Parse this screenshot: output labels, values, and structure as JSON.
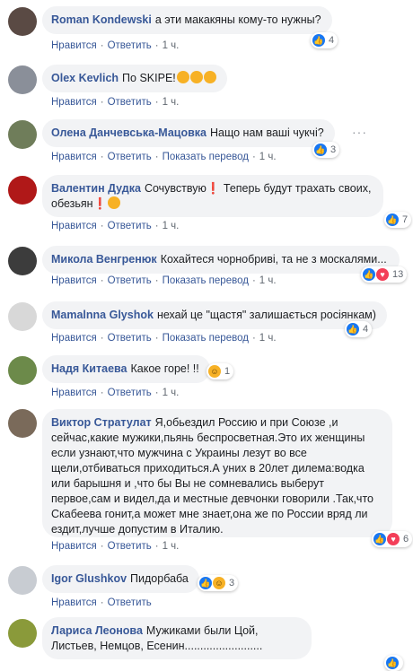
{
  "actions": {
    "like": "Нравится",
    "reply": "Ответить",
    "translate": "Показать перевод"
  },
  "comments": [
    {
      "name": "Roman Kondewski",
      "text": "а эти макакяны кому-то нужны?",
      "time": "1 ч.",
      "reactions": "4",
      "avatar_color": "#5a4a44"
    },
    {
      "name": "Olex Kevlich",
      "text": "По SKIPE!",
      "time": "1 ч.",
      "reactions": "",
      "avatar_color": "#8a8f99"
    },
    {
      "name": "Олена Данчевська-Мацовка",
      "text": "Нащо нам ваші чукчі?",
      "time": "1 ч.",
      "reactions": "3",
      "avatar_color": "#6f7d5a"
    },
    {
      "name": "Валентин Дудка",
      "text": "Сочувствую❗ Теперь будут трахать своих, обезьян❗",
      "time": "1 ч.",
      "reactions": "7",
      "avatar_color": "#b01818"
    },
    {
      "name": "Микола Венгренюк",
      "text": "Кохайтеся чорнобриві, та не з москалями...",
      "time": "1 ч.",
      "reactions": "13",
      "avatar_color": "#3c3c3c"
    },
    {
      "name": "Mamalnna Glyshok",
      "text": "нехай це \"щастя\" залишається росіянкам)",
      "time": "1 ч.",
      "reactions": "4",
      "avatar_color": "#d8d8d8"
    },
    {
      "name": "Надя Китаева",
      "text": "Какое горе! !!",
      "time": "1 ч.",
      "reactions": "1",
      "avatar_color": "#6c8a4a"
    },
    {
      "name": "Виктор Стратулат",
      "text": "Я,обьездил Россию и при Союзе ,и сейчас,какие мужики,пьянь беспросветная.Это их женщины если узнают,что мужчина с Украины лезут во все щели,отбиваться приходиться.А уних в 20лет дилема:водка или барышня и ,что бы Вы не сомневались выберут первое,сам и видел,да и местные девчонки говорили .Так,что Скабеева гонит,а может мне знает,она же по России вряд ли ездит,лучше допустим в Италию.",
      "time": "1 ч.",
      "reactions": "6",
      "avatar_color": "#7a6a5a"
    },
    {
      "name": "Igor Glushkov",
      "text": "Пидорбаба",
      "time": "",
      "reactions": "3",
      "avatar_color": "#c8ccd2"
    },
    {
      "name": "Лариса Леонова",
      "text": "Мужиками были Цой, Листьев, Немцов, Есенин.........................",
      "time": "",
      "reactions": "",
      "avatar_color": "#8a9a3a"
    }
  ]
}
